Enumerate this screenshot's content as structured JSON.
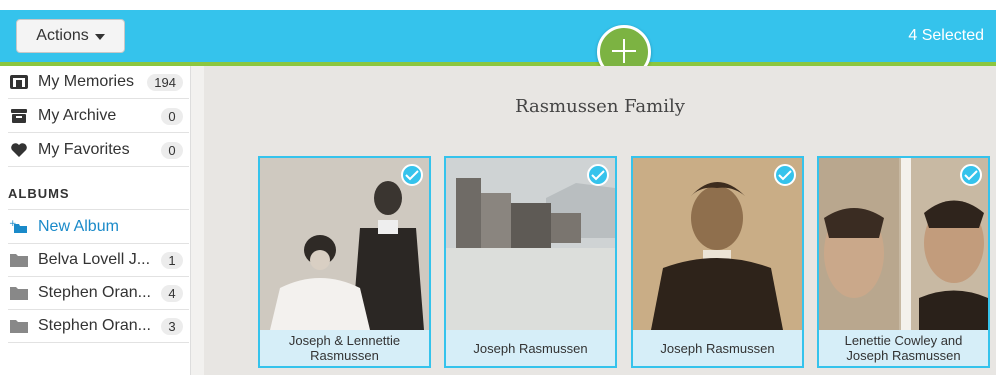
{
  "toolbar": {
    "actions_label": "Actions",
    "selected_label": "4 Selected",
    "add_icon": "plus-icon"
  },
  "sidebar": {
    "items": [
      {
        "label": "My Memories",
        "count": "194",
        "icon": "memories-icon"
      },
      {
        "label": "My Archive",
        "count": "0",
        "icon": "archive-box-icon"
      },
      {
        "label": "My Favorites",
        "count": "0",
        "icon": "heart-icon"
      }
    ],
    "albums_header": "ALBUMS",
    "new_album_label": "New Album",
    "albums": [
      {
        "label": "Belva Lovell J...",
        "count": "1"
      },
      {
        "label": "Stephen Oran...",
        "count": "4"
      },
      {
        "label": "Stephen Oran...",
        "count": "3"
      }
    ]
  },
  "main": {
    "album_title": "Rasmussen Family",
    "photos": [
      {
        "caption": "Joseph & Lennettie Rasmussen",
        "selected": true
      },
      {
        "caption": "Joseph Rasmussen",
        "selected": true
      },
      {
        "caption": "Joseph Rasmussen",
        "selected": true
      },
      {
        "caption": "Lenettie Cowley and Joseph Rasmussen",
        "selected": true
      }
    ]
  },
  "colors": {
    "topbar": "#35c3ec",
    "accent_green": "#8cc63f",
    "link_blue": "#1a8ac9"
  }
}
